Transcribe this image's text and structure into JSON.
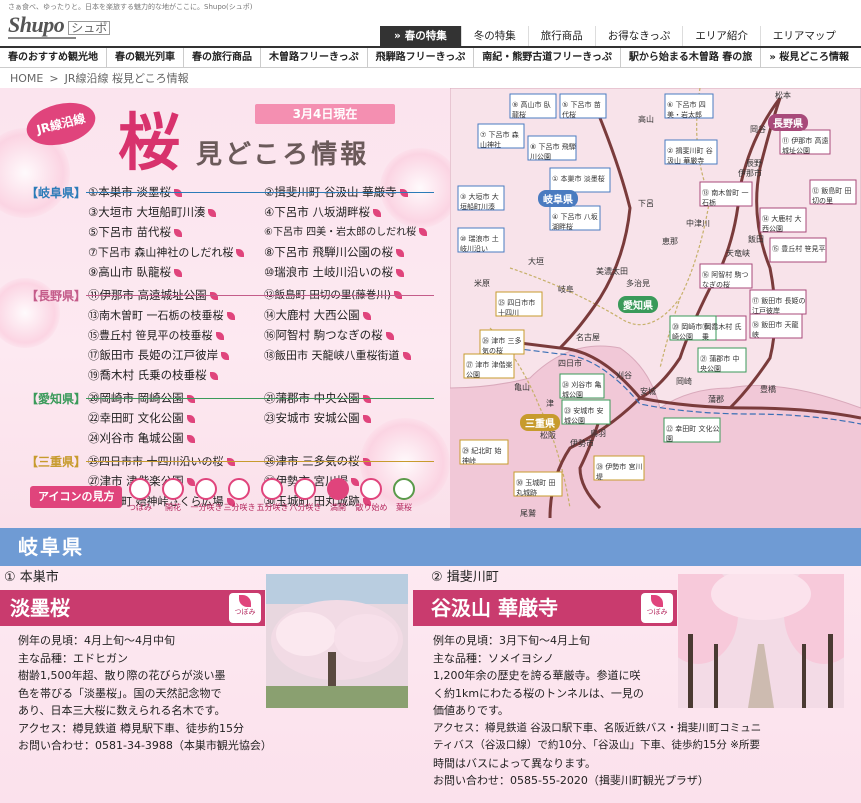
{
  "header": {
    "tagline": "さぁ食べ、ゆったりと。日本を楽旅する魅力的な地がここに。Shupo(シュポ)",
    "logo_main": "Shupo",
    "logo_sub": "シュポ",
    "top_nav": [
      "春の特集",
      "冬の特集",
      "旅行商品",
      "お得なきっぷ",
      "エリア紹介",
      "エリアマップ"
    ],
    "sub_nav": [
      "春のおすすめ観光地",
      "春の観光列車",
      "春の旅行商品",
      "木曽路フリーきっぷ",
      "飛騨路フリーきっぷ",
      "南紀・熊野古道フリーきっぷ",
      "駅から始まる木曽路 春の旅",
      "»  桜見どころ情報"
    ]
  },
  "breadcrumb": {
    "home": "HOME",
    "sep": ">",
    "current": "JR線沿線 桜見どころ情報"
  },
  "hero": {
    "badge": "JR線沿線",
    "date": "3月4日現在",
    "big_char": "桜",
    "title": "見どころ情報",
    "prefs": [
      {
        "key": "gifu",
        "label": "【岐阜県】",
        "spots": [
          "①本巣市 淡墨桜",
          "②揖斐川町 谷汲山 華厳寺",
          "③大垣市 大垣船町川湊",
          "④下呂市 八坂湖畔桜",
          "⑤下呂市 苗代桜",
          "⑥下呂市 四美・岩太郎のしだれ桜",
          "⑦下呂市 森山神社のしだれ桜",
          "⑧下呂市 飛騨川公園の桜",
          "⑨高山市 臥龍桜",
          "⑩瑞浪市 土岐川沿いの桜"
        ]
      },
      {
        "key": "nagano",
        "label": "【長野県】",
        "spots": [
          "⑪伊那市 高遠城址公園",
          "⑫飯島町 田切の里(藤巻川)",
          "⑬南木曽町 一石栃の枝垂桜",
          "⑭大鹿村 大西公園",
          "⑮豊丘村 笹見平の枝垂桜",
          "⑯阿智村 駒つなぎの桜",
          "⑰飯田市 長姫の江戸彼岸",
          "⑱飯田市 天龍峡八重桜街道",
          "⑲喬木村 氏乗の枝垂桜"
        ]
      },
      {
        "key": "aichi",
        "label": "【愛知県】",
        "spots": [
          "⑳岡崎市 岡崎公園",
          "㉑蒲郡市 中央公園",
          "㉒幸田町 文化公園",
          "㉓安城市 安城公園",
          "㉔刈谷市 亀城公園"
        ]
      },
      {
        "key": "mie",
        "label": "【三重県】",
        "spots": [
          "㉕四日市市 十四川沿いの桜",
          "㉖津市 三多気の桜",
          "㉗津市 津偕楽公園",
          "㉘伊勢市 宮川堤",
          "㉙紀北町 始神峠さくら広場",
          "㉚玉城町 田丸城跡"
        ]
      }
    ],
    "icon_legend_title": "アイコンの見方",
    "icon_legend": [
      "つぼみ",
      "開花",
      "一分咲き",
      "三分咲き",
      "五分咲き",
      "八分咲き",
      "満開",
      "散り始め",
      "葉桜"
    ]
  },
  "map": {
    "prefs": [
      "長野県",
      "岐阜県",
      "愛知県",
      "三重県"
    ],
    "callouts": [
      "⑨ 高山市 臥龍桜",
      "⑤ 下呂市 苗代桜",
      "⑥ 下呂市 四美・岩太郎",
      "⑦ 下呂市 森山神社",
      "⑧ 下呂市 飛騨川公園",
      "② 揖斐川町 谷汲山 華厳寺",
      "① 本巣市 淡墨桜",
      "③ 大垣市 大垣船町川湊",
      "④ 下呂市 八坂湖畔桜",
      "⑩ 瑞浪市 土岐川沿い",
      "⑪ 伊那市 高遠城址公園",
      "⑫ 飯島町 田切の里",
      "⑬ 南木曽町 一石栃",
      "⑭ 大鹿村 大西公園",
      "⑮ 豊丘村 笹見平",
      "⑯ 阿智村 駒つなぎの桜",
      "⑰ 飯田市 長姫の江戸彼岸",
      "⑱ 飯田市 天龍峡",
      "⑲ 喬木村 氏乗",
      "⑳ 岡崎市 岡崎公園",
      "㉑ 蒲郡市 中央公園",
      "㉒ 幸田町 文化公園",
      "㉓ 安城市 安城公園",
      "㉔ 刈谷市 亀城公園",
      "㉕ 四日市市 十四川",
      "㉖ 津市 三多気の桜",
      "㉗ 津市 津偕楽公園",
      "㉘ 伊勢市 宮川堤",
      "㉙ 紀北町 始神峠",
      "㉚ 玉城町 田丸城跡"
    ],
    "stations": [
      "松本",
      "岡谷",
      "辰野",
      "伊那市",
      "飯田",
      "天竜峡",
      "中津川",
      "恵那",
      "多治見",
      "岐阜",
      "大垣",
      "名古屋",
      "豊橋",
      "岡崎",
      "刈谷",
      "安城",
      "蒲郡",
      "四日市",
      "津",
      "松阪",
      "伊勢市",
      "鳥羽",
      "高山",
      "下呂",
      "美濃太田",
      "米原",
      "亀山",
      "尾鷲"
    ]
  },
  "section": {
    "title": "岐阜県",
    "cards": [
      {
        "sub": "① 本巣市",
        "title": "淡墨桜",
        "status": "つぼみ",
        "lines": [
          "例年の見頃：4月上旬〜4月中旬",
          "主な品種：エドヒガン",
          "樹齢1,500年超、散り際の花びらが淡い墨",
          "色を帯びる「淡墨桜」。国の天然記念物で",
          "あり、日本三大桜に数えられる名木です。",
          "アクセス：樽見鉄道 樽見駅下車、徒歩約15分",
          "お問い合わせ：0581-34-3988（本巣市観光協会）"
        ]
      },
      {
        "sub": "② 揖斐川町",
        "title": "谷汲山 華厳寺",
        "status": "つぼみ",
        "lines": [
          "例年の見頃：3月下旬〜4月上旬",
          "主な品種：ソメイヨシノ",
          "1,200年余の歴史を誇る華厳寺。参道に咲",
          "く約1kmにわたる桜のトンネルは、一見の",
          "価値ありです。",
          "アクセス：樽見鉄道 谷汲口駅下車、名阪近鉄バス・揖斐川町コミュニ",
          "ティバス（谷汲口線）で約10分、「谷汲山」下車、徒歩約15分 ※所要",
          "時間はバスによって異なります。",
          "お問い合わせ：0585-55-2020（揖斐川町観光プラザ）"
        ]
      }
    ]
  }
}
